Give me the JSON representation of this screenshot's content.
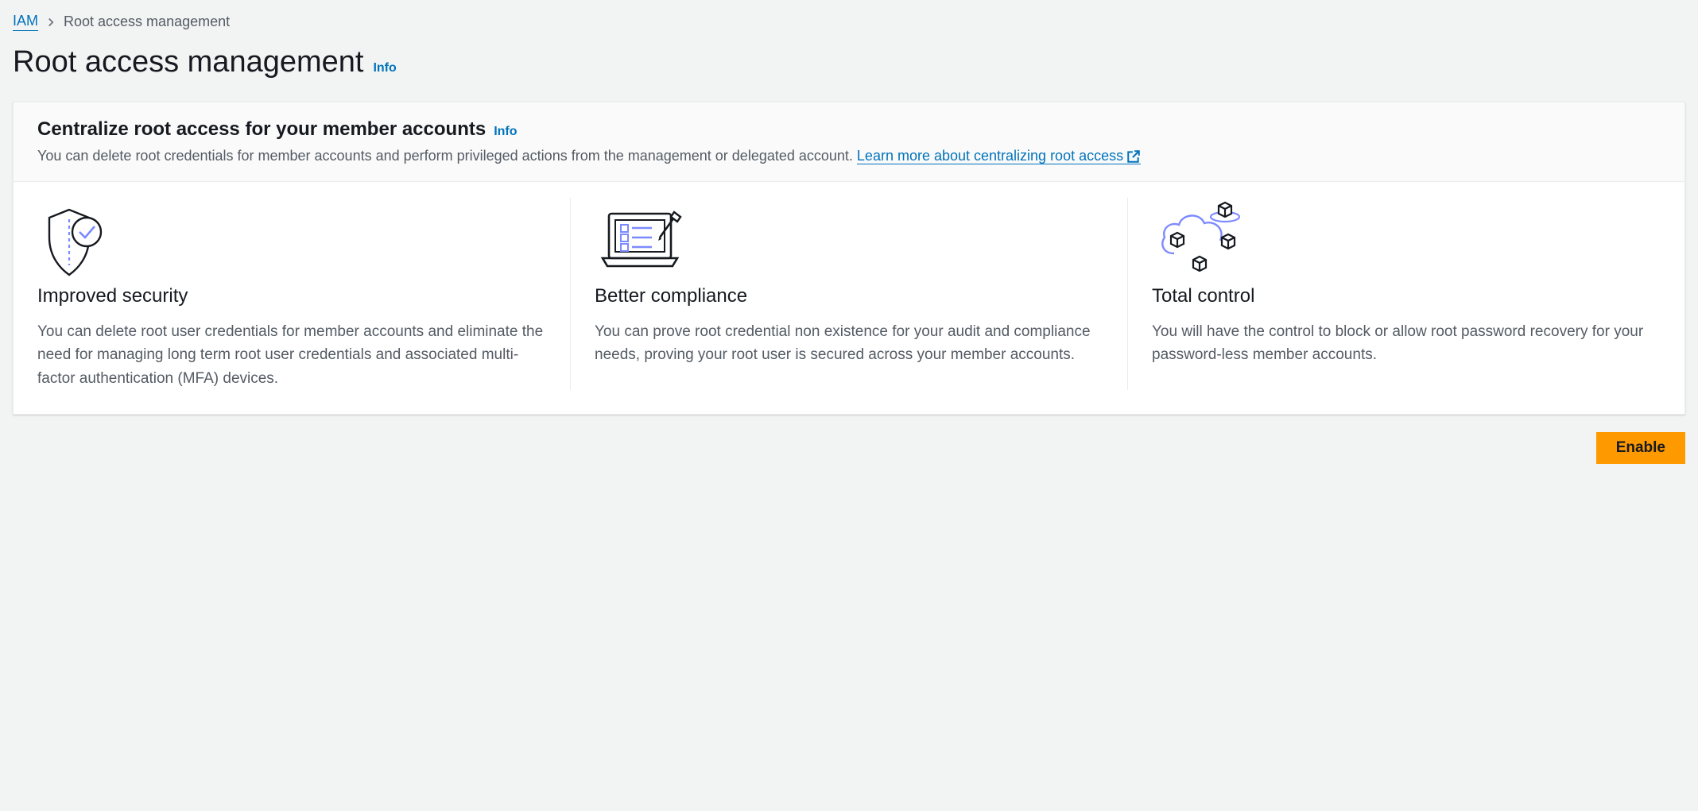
{
  "breadcrumb": {
    "root": "IAM",
    "current": "Root access management"
  },
  "header": {
    "title": "Root access management",
    "info": "Info"
  },
  "panel": {
    "title": "Centralize root access for your member accounts",
    "info": "Info",
    "subtitle_prefix": "You can delete root credentials for member accounts and perform privileged actions from the management or delegated account. ",
    "learn_more": "Learn more about centralizing root access"
  },
  "features": [
    {
      "title": "Improved security",
      "desc": "You can delete root user credentials for member accounts and eliminate the need for managing long term root user credentials and associated multi-factor authentication (MFA) devices."
    },
    {
      "title": "Better compliance",
      "desc": "You can prove root credential non existence for your audit and compliance needs, proving your root user is secured across your member accounts."
    },
    {
      "title": "Total control",
      "desc": "You will have the control to block or allow root password recovery for your password-less member accounts."
    }
  ],
  "actions": {
    "enable": "Enable"
  }
}
